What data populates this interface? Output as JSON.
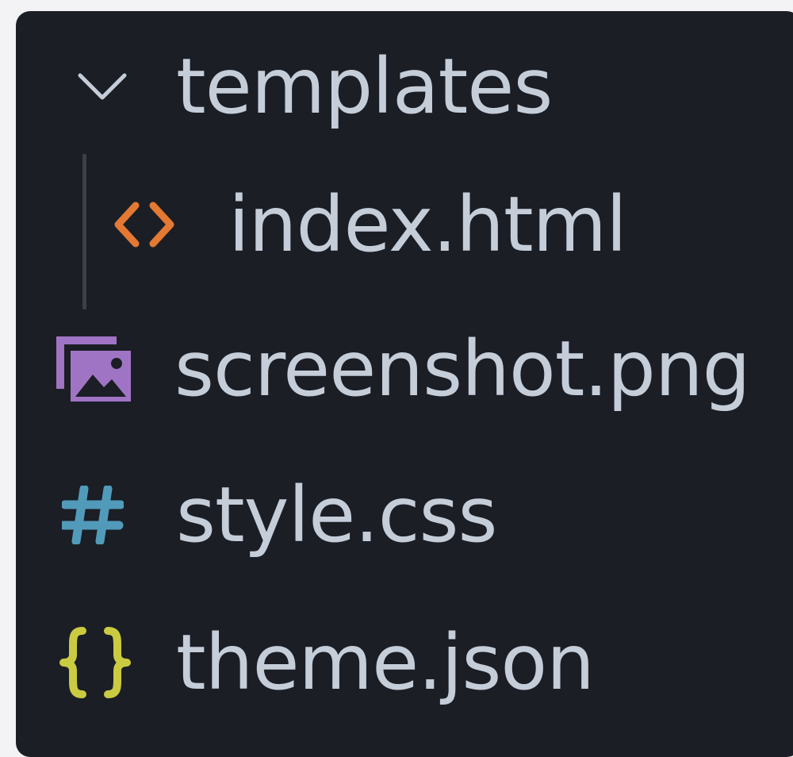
{
  "explorer": {
    "items": [
      {
        "label": "templates",
        "icon": "chevron-down-icon",
        "kind": "folder",
        "expanded": true
      },
      {
        "label": "index.html",
        "icon": "html-file-icon",
        "kind": "file",
        "color": "#e37933"
      },
      {
        "label": "screenshot.png",
        "icon": "image-file-icon",
        "kind": "file",
        "color": "#a074c4"
      },
      {
        "label": "style.css",
        "icon": "css-file-icon",
        "kind": "file",
        "color": "#519aba"
      },
      {
        "label": "theme.json",
        "icon": "json-file-icon",
        "kind": "file",
        "color": "#cbcb41"
      }
    ]
  },
  "colors": {
    "background": "#1b1e25",
    "text": "#c5cdd9",
    "chevron": "#c5cdd9",
    "guide": "#3b3f48"
  }
}
